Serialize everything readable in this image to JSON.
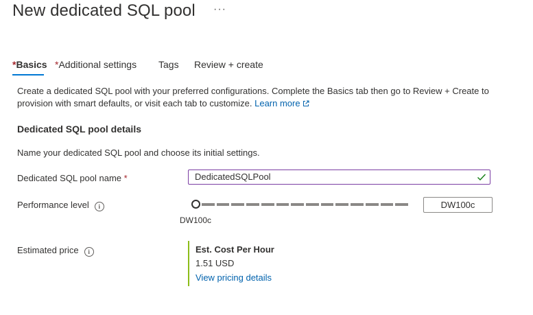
{
  "header": {
    "title": "New dedicated SQL pool",
    "more_label": "···"
  },
  "tabs": [
    {
      "required": "*",
      "label": "Basics",
      "active": true
    },
    {
      "required": "*",
      "label": "Additional settings",
      "active": false
    },
    {
      "required": "",
      "label": "Tags",
      "active": false
    },
    {
      "required": "",
      "label": "Review + create",
      "active": false
    }
  ],
  "intro": {
    "text": "Create a dedicated SQL pool with your preferred configurations. Complete the Basics tab then go to Review + Create to provision with smart defaults, or visit each tab to customize.",
    "link_label": "Learn more"
  },
  "details": {
    "title": "Dedicated SQL pool details",
    "subtitle": "Name your dedicated SQL pool and choose its initial settings."
  },
  "fields": {
    "name_label": "Dedicated SQL pool name",
    "name_required": "*",
    "name_value": "DedicatedSQLPool",
    "perf_label": "Performance level",
    "perf_value": "DW100c",
    "perf_slider_label": "DW100c",
    "perf_slider_level": 0,
    "price_label": "Estimated price"
  },
  "price": {
    "heading": "Est. Cost Per Hour",
    "value": "1.51 USD",
    "link_label": "View pricing details"
  },
  "colors": {
    "accent": "#0078d4",
    "link": "#0062ad",
    "required": "#a4262c",
    "valid_input_border": "#7a3da3",
    "valid_check": "#107c10",
    "price_bar": "#8cbd18"
  },
  "icons": {
    "more": "more-icon",
    "info": "info-icon",
    "external_link": "external-link-icon",
    "check": "check-icon"
  }
}
